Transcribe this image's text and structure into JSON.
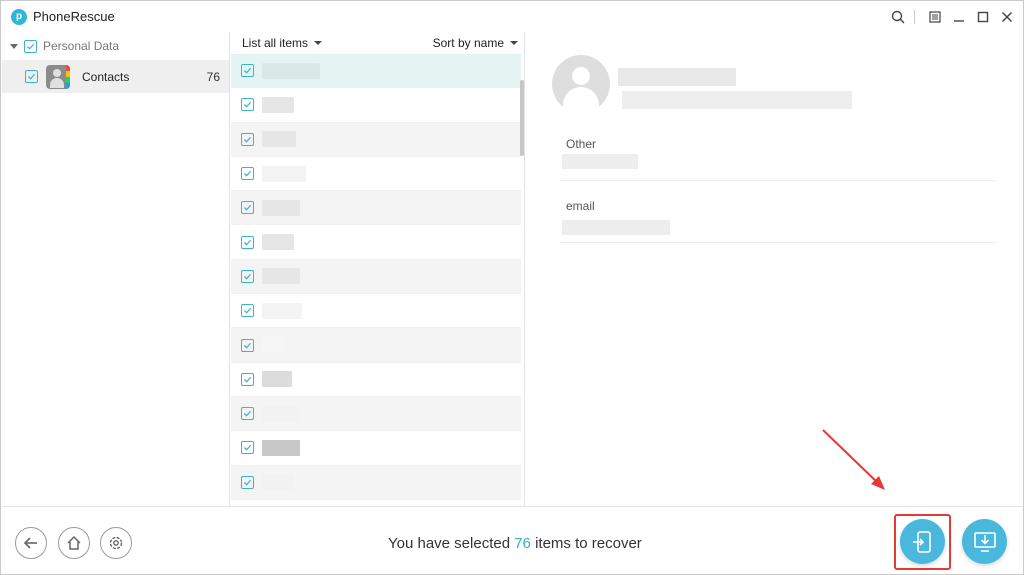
{
  "app": {
    "title": "PhoneRescue",
    "logo_letter": "p"
  },
  "title_controls": [
    "search-icon",
    "menu-icon",
    "minimize-icon",
    "maximize-icon",
    "close-icon"
  ],
  "sidebar": {
    "category_label": "Personal Data",
    "items": [
      {
        "label": "Contacts",
        "count": "76"
      }
    ]
  },
  "list": {
    "filter_label": "List all items",
    "sort_label": "Sort by name",
    "row_count": 13
  },
  "detail": {
    "fields": [
      {
        "label": "Other"
      },
      {
        "label": "email"
      }
    ]
  },
  "footer": {
    "status_prefix": "You have selected",
    "selected_count": "76",
    "status_suffix": "items to recover"
  },
  "colors": {
    "accent": "#38b0b6",
    "action_button": "#49b8dc",
    "highlight": "#e53935",
    "selected_row": "#e3f4f3"
  }
}
